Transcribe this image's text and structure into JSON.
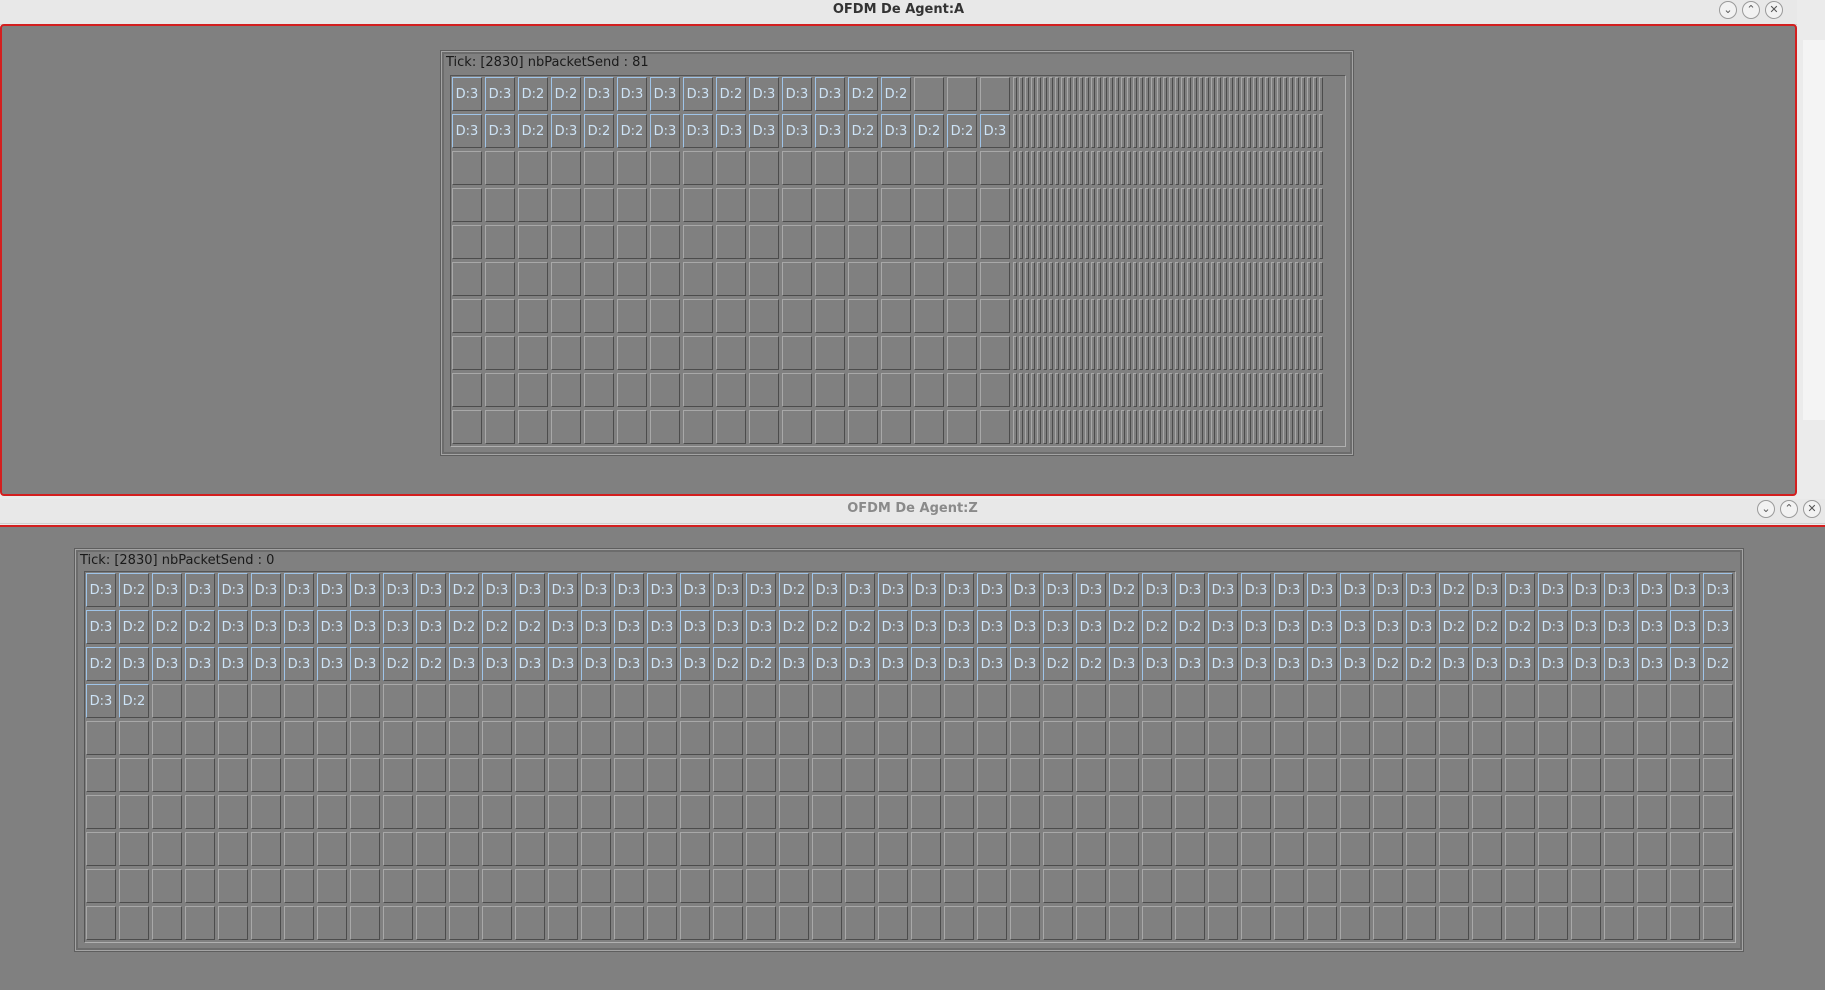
{
  "window_a": {
    "title": "OFDM De Agent:A",
    "panel_label": "Tick: [2830] nbPacketSend : 81",
    "rows": [
      [
        "D:3",
        "D:3",
        "D:2",
        "D:2",
        "D:3",
        "D:3",
        "D:3",
        "D:3",
        "D:2",
        "D:3",
        "D:3",
        "D:3",
        "D:2",
        "D:2"
      ],
      [
        "D:3",
        "D:3",
        "D:2",
        "D:3",
        "D:2",
        "D:2",
        "D:3",
        "D:3",
        "D:3",
        "D:3",
        "D:3",
        "D:3",
        "D:2",
        "D:3",
        "D:2",
        "D:2",
        "D:3"
      ],
      [],
      [],
      [],
      [],
      [],
      [],
      [],
      []
    ],
    "wide_cols": 17,
    "thin_cols": 52
  },
  "window_z": {
    "title": "OFDM De Agent:Z",
    "panel_label": "Tick: [2830] nbPacketSend : 0",
    "rows": [
      [
        "D:3",
        "D:2",
        "D:3",
        "D:3",
        "D:3",
        "D:3",
        "D:3",
        "D:3",
        "D:3",
        "D:3",
        "D:3",
        "D:2",
        "D:3",
        "D:3",
        "D:3",
        "D:3",
        "D:3",
        "D:3",
        "D:3",
        "D:3",
        "D:3",
        "D:2",
        "D:3",
        "D:3",
        "D:3",
        "D:3",
        "D:3",
        "D:3",
        "D:3",
        "D:3",
        "D:3",
        "D:2",
        "D:3",
        "D:3",
        "D:3",
        "D:3",
        "D:3",
        "D:3",
        "D:3",
        "D:3",
        "D:3",
        "D:2",
        "D:3",
        "D:3",
        "D:3",
        "D:3",
        "D:3",
        "D:3",
        "D:3",
        "D:3"
      ],
      [
        "D:3",
        "D:2",
        "D:2",
        "D:2",
        "D:3",
        "D:3",
        "D:3",
        "D:3",
        "D:3",
        "D:3",
        "D:3",
        "D:2",
        "D:2",
        "D:2",
        "D:3",
        "D:3",
        "D:3",
        "D:3",
        "D:3",
        "D:3",
        "D:3",
        "D:2",
        "D:2",
        "D:2",
        "D:3",
        "D:3",
        "D:3",
        "D:3",
        "D:3",
        "D:3",
        "D:3",
        "D:2",
        "D:2",
        "D:2",
        "D:3",
        "D:3",
        "D:3",
        "D:3",
        "D:3",
        "D:3",
        "D:3",
        "D:2",
        "D:2",
        "D:2",
        "D:3",
        "D:3",
        "D:3",
        "D:3",
        "D:3",
        "D:3"
      ],
      [
        "D:2",
        "D:3",
        "D:3",
        "D:3",
        "D:3",
        "D:3",
        "D:3",
        "D:3",
        "D:3",
        "D:2",
        "D:2",
        "D:3",
        "D:3",
        "D:3",
        "D:3",
        "D:3",
        "D:3",
        "D:3",
        "D:3",
        "D:2",
        "D:2",
        "D:3",
        "D:3",
        "D:3",
        "D:3",
        "D:3",
        "D:3",
        "D:3",
        "D:3",
        "D:2",
        "D:2",
        "D:3",
        "D:3",
        "D:3",
        "D:3",
        "D:3",
        "D:3",
        "D:3",
        "D:3",
        "D:2",
        "D:2",
        "D:3",
        "D:3",
        "D:3",
        "D:3",
        "D:3",
        "D:3",
        "D:3",
        "D:3",
        "D:2"
      ],
      [
        "D:3",
        "D:2"
      ],
      [],
      [],
      [],
      [],
      [],
      []
    ],
    "cols": 50
  },
  "controls": {
    "minimize_icon": "chevron-down-icon",
    "maximize_icon": "chevron-up-icon",
    "close_icon": "close-icon"
  }
}
